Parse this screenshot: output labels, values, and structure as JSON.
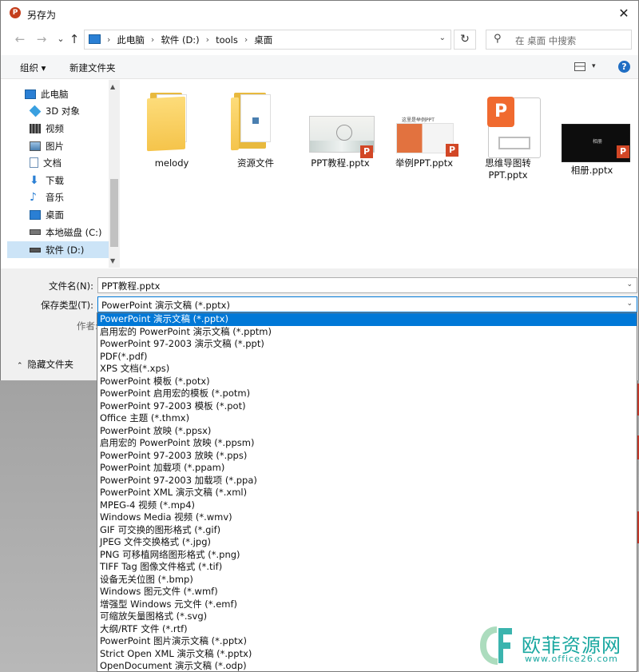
{
  "window": {
    "title": "另存为",
    "app_icon": "powerpoint-icon",
    "close_label": "✕"
  },
  "navigation": {
    "back": "←",
    "forward": "→",
    "recent": "⌄",
    "up": "↑",
    "breadcrumbs": [
      "此电脑",
      "软件 (D:)",
      "tools",
      "桌面"
    ],
    "refresh": "↻",
    "search_placeholder": "在 桌面 中搜索"
  },
  "toolbar": {
    "organize": "组织 ▾",
    "new_folder": "新建文件夹",
    "help": "?"
  },
  "sidebar": {
    "items": [
      {
        "label": "此电脑",
        "icon": "computer-icon",
        "color": "#2a7fd4"
      },
      {
        "label": "3D 对象",
        "icon": "3d-objects-icon",
        "color": "#3aa0e0"
      },
      {
        "label": "视频",
        "icon": "video-icon",
        "color": "#333333"
      },
      {
        "label": "图片",
        "icon": "pictures-icon",
        "color": "#4a7fb0"
      },
      {
        "label": "文档",
        "icon": "documents-icon",
        "color": "#6b8fb5"
      },
      {
        "label": "下载",
        "icon": "download-icon",
        "color": "#2a7fd4"
      },
      {
        "label": "音乐",
        "icon": "music-icon",
        "color": "#2a7fd4"
      },
      {
        "label": "桌面",
        "icon": "desktop-icon",
        "color": "#2a7fd4"
      },
      {
        "label": "本地磁盘 (C:)",
        "icon": "drive-c-icon",
        "color": "#555555"
      },
      {
        "label": "软件 (D:)",
        "icon": "drive-d-icon",
        "color": "#555555",
        "selected": true
      }
    ]
  },
  "files": [
    {
      "name": "melody",
      "type": "folder"
    },
    {
      "name": "资源文件",
      "type": "folder-doc"
    },
    {
      "name": "PPT教程.pptx",
      "type": "pptx-light"
    },
    {
      "name": "举例PPT.pptx",
      "type": "pptx-orange",
      "thumb_caption": "这里是举例PPT"
    },
    {
      "name": "思维导图转PPT.pptx",
      "type": "pptx-icon"
    },
    {
      "name": "相册.pptx",
      "type": "pptx-dark",
      "thumb_caption": "相册"
    }
  ],
  "form": {
    "filename_label": "文件名(N):",
    "filename_value": "PPT教程.pptx",
    "filetype_label": "保存类型(T):",
    "filetype_value": "PowerPoint 演示文稿 (*.pptx)",
    "author_label": "作者:",
    "hide_folders": "隐藏文件夹"
  },
  "filetype_options": [
    "PowerPoint 演示文稿 (*.pptx)",
    "启用宏的 PowerPoint 演示文稿 (*.pptm)",
    "PowerPoint 97-2003 演示文稿 (*.ppt)",
    "PDF(*.pdf)",
    "XPS 文档(*.xps)",
    "PowerPoint 模板 (*.potx)",
    "PowerPoint 启用宏的模板 (*.potm)",
    "PowerPoint 97-2003 模板 (*.pot)",
    "Office 主题 (*.thmx)",
    "PowerPoint 放映 (*.ppsx)",
    "启用宏的 PowerPoint 放映 (*.ppsm)",
    "PowerPoint 97-2003 放映 (*.pps)",
    "PowerPoint 加载项 (*.ppam)",
    "PowerPoint 97-2003 加载项 (*.ppa)",
    "PowerPoint XML 演示文稿 (*.xml)",
    "MPEG-4 视频 (*.mp4)",
    "Windows Media 视频 (*.wmv)",
    "GIF 可交换的图形格式 (*.gif)",
    "JPEG 文件交换格式 (*.jpg)",
    "PNG 可移植网络图形格式 (*.png)",
    "TIFF Tag 图像文件格式 (*.tif)",
    "设备无关位图 (*.bmp)",
    "Windows 图元文件 (*.wmf)",
    "增强型 Windows 元文件 (*.emf)",
    "可缩放矢量图格式 (*.svg)",
    "大纲/RTF 文件 (*.rtf)",
    "PowerPoint 图片演示文稿 (*.pptx)",
    "Strict Open XML 演示文稿 (*.pptx)",
    "OpenDocument 演示文稿 (*.odp)"
  ],
  "watermark": {
    "name": "欧菲资源网",
    "url": "www.office26.com",
    "color": "#19a7a0"
  },
  "colors": {
    "accent": "#0078d7",
    "selection": "#cce4f7",
    "ppt": "#d24726"
  }
}
